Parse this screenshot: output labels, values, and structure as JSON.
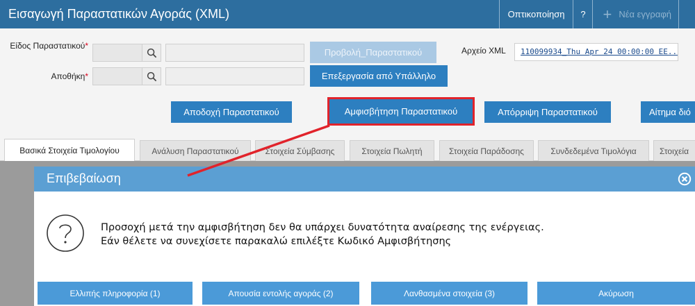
{
  "header": {
    "title": "Εισαγωγή Παραστατικών Αγοράς (XML)",
    "view_button": "Οπτικοποίηση",
    "help_button": "?",
    "new_button_icon": "+",
    "new_button": "Νέα εγγραφή"
  },
  "form": {
    "doc_type_label": "Είδος Παραστατικού",
    "warehouse_label": "Αποθήκη",
    "required_mark": "*",
    "view_doc_button": "Προβολή_Παραστατικού",
    "employee_button": "Επεξεργασία από Υπάλληλο",
    "xml_label": "Αρχείο XML",
    "xml_value": "110099934_Thu Apr 24 00:00:00 EE..."
  },
  "actions": {
    "accept": "Αποδοχή Παραστατικού",
    "dispute": "Αμφισβήτηση Παραστατικού",
    "reject": "Απόρριψη Παραστατικού",
    "request": "Αίτημα διό"
  },
  "tabs": [
    {
      "label": "Βασικά Στοιχεία Τιμολογίου"
    },
    {
      "label": "Ανάλυση Παραστατικού"
    },
    {
      "label": "Στοιχεία Σύμβασης"
    },
    {
      "label": "Στοιχεία Πωλητή"
    },
    {
      "label": "Στοιχεία Παράδοσης"
    },
    {
      "label": "Συνδεδεμένα Τιμολόγια"
    },
    {
      "label": "Στοιχεία"
    }
  ],
  "dialog": {
    "title": "Επιβεβαίωση",
    "message_line1": "Προσοχή μετά την αμφισβήτηση δεν θα υπάρχει δυνατότητα αναίρεσης της ενέργειας.",
    "message_line2": "Εάν θέλετε να συνεχίσετε παρακαλώ επιλέξτε Κωδικό Αμφισβήτησης",
    "buttons": {
      "incomplete": "Ελλιπής πληροφορία (1)",
      "no_order": "Απουσία εντολής αγοράς (2)",
      "wrong_data": "Λανθασμένα στοιχεία (3)",
      "cancel": "Ακύρωση"
    }
  },
  "colors": {
    "header_bg": "#2d6e9f",
    "button_blue": "#2d7fc0",
    "dialog_header": "#5b9fd3",
    "annotation_red": "#e1232b"
  },
  "icons": [
    "search-icon",
    "plus-icon",
    "close-icon",
    "question-icon"
  ]
}
